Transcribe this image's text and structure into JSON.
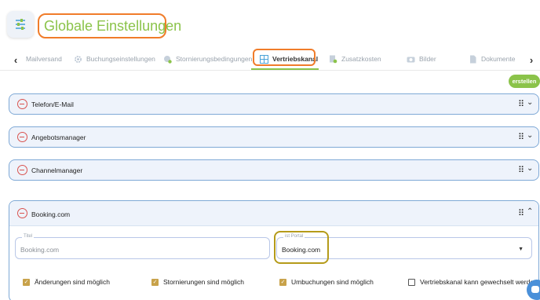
{
  "header": {
    "title": "Globale Einstellungen"
  },
  "tabs": [
    {
      "label": "Mailversand",
      "icon": "mail-icon"
    },
    {
      "label": "Buchungseinstellungen",
      "icon": "gear-icon"
    },
    {
      "label": "Stornierungsbedingungen",
      "icon": "settings-badge-icon"
    },
    {
      "label": "Vertriebskanal",
      "icon": "grid-icon",
      "active": true
    },
    {
      "label": "Zusatzkosten",
      "icon": "document-add-icon"
    },
    {
      "label": "Bilder",
      "icon": "camera-icon"
    },
    {
      "label": "Dokumente",
      "icon": "document-icon"
    }
  ],
  "nav": {
    "left": "‹",
    "right": "›"
  },
  "create_button": "erstellen",
  "panels": [
    {
      "label": "Telefon/E-Mail"
    },
    {
      "label": "Angebotsmanager"
    },
    {
      "label": "Channelmanager"
    },
    {
      "label": "Booking.com"
    }
  ],
  "form": {
    "title_label": "Titel",
    "title_value": "Booking.com",
    "portal_label": "ist Portal",
    "portal_value": "Booking.com"
  },
  "checkboxes": [
    {
      "label": "Änderungen sind möglich",
      "checked": true
    },
    {
      "label": "Stornierungen sind möglich",
      "checked": true
    },
    {
      "label": "Umbuchungen sind möglich",
      "checked": true
    },
    {
      "label": "Vertriebskanal kann gewechselt werden",
      "checked": false
    }
  ],
  "colors": {
    "accent_green": "#8bc34a",
    "annotation_orange": "#f07c2a",
    "annotation_olive": "#b59b1a",
    "panel_border": "#7fa9d6",
    "remove_red": "#d9534f"
  }
}
